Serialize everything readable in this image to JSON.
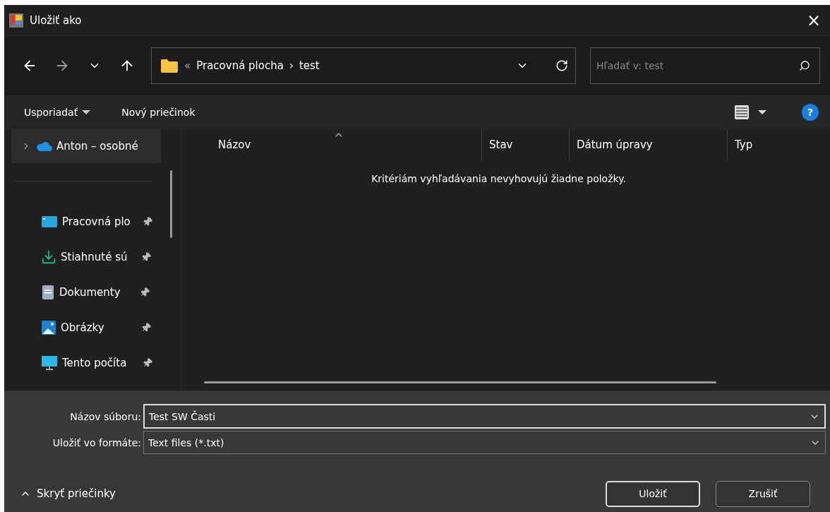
{
  "window": {
    "title": "Uložiť ako",
    "close": "×"
  },
  "nav": {
    "breadcrumb_prefix": "«",
    "path": [
      {
        "label": "Pracovná plocha"
      },
      {
        "label": "test"
      }
    ],
    "separator": "›",
    "search": {
      "placeholder": "Hľadať v: test"
    }
  },
  "commands": {
    "organize": "Usporiadať",
    "new_folder": "Nový priečinok",
    "help": "?"
  },
  "sidebar": {
    "items": [
      {
        "kind": "cloud",
        "label": "Anton – osobné",
        "selected": true,
        "pinned": false,
        "expandable": true
      },
      {
        "kind": "divider"
      },
      {
        "kind": "desktop",
        "label": "Pracovná plo",
        "selected": false,
        "pinned": true,
        "expandable": false
      },
      {
        "kind": "download",
        "label": "Stiahnuté sú",
        "selected": false,
        "pinned": true,
        "expandable": false
      },
      {
        "kind": "document",
        "label": "Dokumenty",
        "selected": false,
        "pinned": true,
        "expandable": false
      },
      {
        "kind": "pictures",
        "label": "Obrázky",
        "selected": false,
        "pinned": true,
        "expandable": false
      },
      {
        "kind": "computer",
        "label": "Tento počíta",
        "selected": false,
        "pinned": true,
        "expandable": false
      }
    ]
  },
  "table": {
    "columns": [
      {
        "label": "Názov",
        "sorted": true
      },
      {
        "label": "Stav",
        "sorted": false
      },
      {
        "label": "Dátum úpravy",
        "sorted": false
      },
      {
        "label": "Typ",
        "sorted": false
      }
    ],
    "empty_message": "Kritériám vyhľadávania nevyhovujú žiadne položky."
  },
  "form": {
    "fields": [
      {
        "label": "Názov súboru:",
        "value": "Test SW Časti",
        "focused": true
      },
      {
        "label": "Uložiť vo formáte:",
        "value": "Text files (*.txt)",
        "focused": false
      }
    ]
  },
  "footer": {
    "toggle": "Skryť priečinky",
    "buttons": [
      {
        "label": "Uložiť",
        "default": true
      },
      {
        "label": "Zrušiť",
        "default": false
      }
    ]
  }
}
